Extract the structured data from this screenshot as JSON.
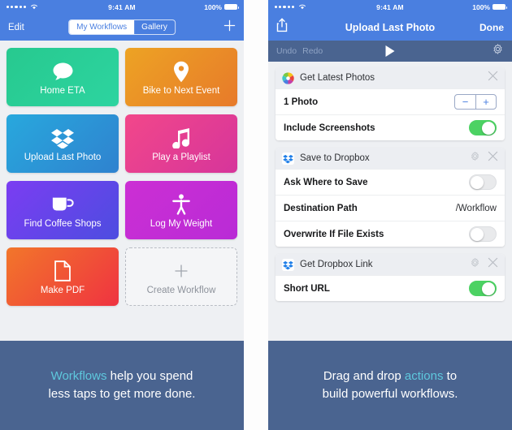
{
  "left_phone": {
    "status_bar": {
      "carrier_dots": 5,
      "wifi_icon": "wifi-icon",
      "time": "9:41 AM",
      "battery_percent": "100%"
    },
    "nav": {
      "edit_label": "Edit",
      "segments": [
        {
          "label": "My Workflows",
          "active": true
        },
        {
          "label": "Gallery",
          "active": false
        }
      ],
      "add_icon": "plus-icon"
    },
    "tiles": [
      {
        "label": "Home ETA",
        "icon": "speech-bubble-icon",
        "color_from": "#27c98f",
        "color_to": "#2dd4a0"
      },
      {
        "label": "Bike to Next Event",
        "icon": "map-pin-icon",
        "color_from": "#eda324",
        "color_to": "#e77a2a"
      },
      {
        "label": "Upload Last Photo",
        "icon": "dropbox-icon",
        "color_from": "#28a8dd",
        "color_to": "#2f82cf"
      },
      {
        "label": "Play a Playlist",
        "icon": "music-note-icon",
        "color_from": "#f2478a",
        "color_to": "#d6359b"
      },
      {
        "label": "Find Coffee Shops",
        "icon": "coffee-cup-icon",
        "color_from": "#7b3df2",
        "color_to": "#4d4de0"
      },
      {
        "label": "Log My Weight",
        "icon": "person-icon",
        "color_from": "#cc2fd4",
        "color_to": "#b92bd6"
      },
      {
        "label": "Make PDF",
        "icon": "document-icon",
        "color_from": "#f2762a",
        "color_to": "#ef3341"
      }
    ],
    "create_tile": {
      "label": "Create Workflow",
      "icon": "plus-icon"
    },
    "caption": {
      "highlight": "Workflows",
      "rest": " help you spend",
      "line2": "less taps to get more done."
    }
  },
  "right_phone": {
    "status_bar": {
      "carrier_dots": 5,
      "wifi_icon": "wifi-icon",
      "time": "9:41 AM",
      "battery_percent": "100%"
    },
    "nav": {
      "share_icon": "share-icon",
      "title": "Upload Last Photo",
      "done_label": "Done"
    },
    "toolbar": {
      "undo_label": "Undo",
      "redo_label": "Redo",
      "play_icon": "play-icon",
      "settings_icon": "gear-icon"
    },
    "cards": [
      {
        "title": "Get Latest Photos",
        "icon": "photos-icon",
        "has_gear": false,
        "close_icon": "close-icon",
        "rows": [
          {
            "label": "1 Photo",
            "control": "stepper",
            "minus": "−",
            "plus": "+"
          },
          {
            "label": "Include Screenshots",
            "control": "toggle",
            "on": true
          }
        ]
      },
      {
        "title": "Save to Dropbox",
        "icon": "dropbox-icon",
        "has_gear": true,
        "gear_icon": "gear-icon",
        "close_icon": "close-icon",
        "rows": [
          {
            "label": "Ask Where to Save",
            "control": "toggle",
            "on": false
          },
          {
            "label": "Destination Path",
            "control": "value",
            "value": "/Workflow"
          },
          {
            "label": "Overwrite If File Exists",
            "control": "toggle",
            "on": false
          }
        ]
      },
      {
        "title": "Get Dropbox Link",
        "icon": "dropbox-icon",
        "has_gear": true,
        "gear_icon": "gear-icon",
        "close_icon": "close-icon",
        "rows": [
          {
            "label": "Short URL",
            "control": "toggle",
            "on": true
          }
        ]
      }
    ],
    "caption": {
      "pre": "Drag and drop ",
      "highlight": "actions",
      "post": " to",
      "line2": "build powerful workflows."
    }
  },
  "theme": {
    "brand_blue": "#4a7fe0",
    "caption_bg": "#4a6490",
    "caption_highlight": "#5ec8dd",
    "toggle_on": "#4cd263"
  }
}
